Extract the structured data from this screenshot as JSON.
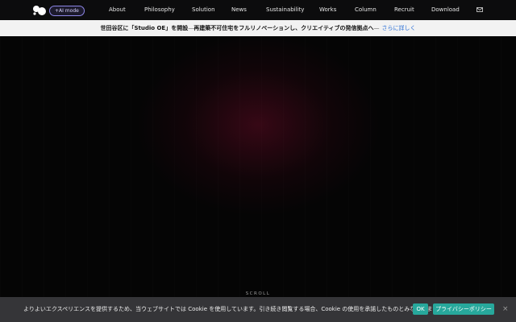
{
  "nav": {
    "ai_mode_label": "+AI mode",
    "links": [
      "About",
      "Philosophy",
      "Solution",
      "News",
      "Sustainability",
      "Works",
      "Column",
      "Recruit",
      "Download"
    ]
  },
  "announcement": {
    "main": "世田谷区に「Studio OE」を開設",
    "dash1": " — ",
    "sub": "再建築不可住宅をフルリノベーションし、クリエイティブの発信拠点へ",
    "dash2": " — ",
    "link": "さらに詳しく"
  },
  "hero": {
    "scroll_label": "SCROLL"
  },
  "cookie": {
    "text": "よりよいエクスペリエンスを提供するため、当ウェブサイトでは Cookie を使用しています。引き続き閲覧する場合、Cookie の使用を承諾したものとみなされます。",
    "ok_label": "OK",
    "privacy_label": "プライバシーポリシー",
    "close_label": "×"
  },
  "colors": {
    "accent_teal": "#27a89c",
    "ai_border": "#8d86e6",
    "link_blue": "#2a6fd6"
  }
}
